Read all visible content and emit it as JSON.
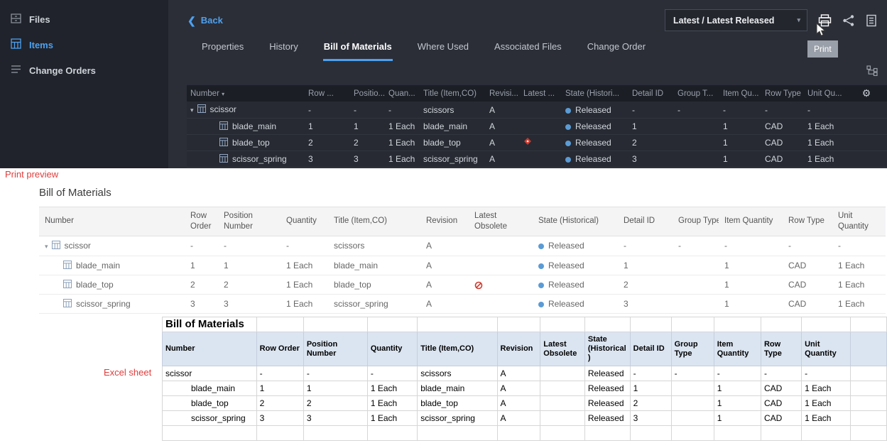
{
  "colors": {
    "accent_blue": "#4da1f0",
    "released_dot": "#5b9bd5",
    "obsolete_red": "#cf3a2d",
    "excel_header_bg": "#dbe5f1",
    "annotation_red": "#e03c3c"
  },
  "annotations": {
    "print_preview": "Print preview",
    "excel_sheet": "Excel sheet"
  },
  "sidebar": {
    "items": [
      {
        "label": "Files"
      },
      {
        "label": "Items"
      },
      {
        "label": "Change Orders"
      }
    ]
  },
  "toolbar": {
    "back_label": "Back",
    "version_selector": "Latest / Latest Released",
    "print_tooltip": "Print"
  },
  "tabs": [
    {
      "label": "Properties"
    },
    {
      "label": "History"
    },
    {
      "label": "Bill of Materials"
    },
    {
      "label": "Where Used"
    },
    {
      "label": "Associated Files"
    },
    {
      "label": "Change Order"
    }
  ],
  "dark_table": {
    "columns": [
      "Number",
      "Row ...",
      "Positio...",
      "Quan...",
      "Title (Item,CO)",
      "Revisi...",
      "Latest ...",
      "State (Histori...",
      "Detail ID",
      "Group T...",
      "Item Qu...",
      "Row Type",
      "Unit Qu..."
    ]
  },
  "rows": [
    {
      "number": "scissor",
      "row_order": "-",
      "position_number": "-",
      "quantity": "-",
      "title": "scissors",
      "revision": "A",
      "state": "Released",
      "detail_id": "-",
      "group_type": "-",
      "item_quantity": "-",
      "row_type": "-",
      "unit_quantity": "-"
    },
    {
      "number": "blade_main",
      "row_order": "1",
      "position_number": "1",
      "quantity": "1 Each",
      "title": "blade_main",
      "revision": "A",
      "state": "Released",
      "detail_id": "1",
      "group_type": "",
      "item_quantity": "1",
      "row_type": "CAD",
      "unit_quantity": "1 Each"
    },
    {
      "number": "blade_top",
      "row_order": "2",
      "position_number": "2",
      "quantity": "1 Each",
      "title": "blade_top",
      "revision": "A",
      "state": "Released",
      "detail_id": "2",
      "group_type": "",
      "item_quantity": "1",
      "row_type": "CAD",
      "unit_quantity": "1 Each"
    },
    {
      "number": "scissor_spring",
      "row_order": "3",
      "position_number": "3",
      "quantity": "1 Each",
      "title": "scissor_spring",
      "revision": "A",
      "state": "Released",
      "detail_id": "3",
      "group_type": "",
      "item_quantity": "1",
      "row_type": "CAD",
      "unit_quantity": "1 Each"
    }
  ],
  "print_preview": {
    "title": "Bill of Materials",
    "columns": [
      "Number",
      "Row Order",
      "Position Number",
      "Quantity",
      "Title (Item,CO)",
      "Revision",
      "Latest Obsolete",
      "State (Historical)",
      "Detail ID",
      "Group Type",
      "Item Quantity",
      "Row Type",
      "Unit Quantity"
    ]
  },
  "excel": {
    "title": "Bill of Materials",
    "columns": [
      "Number",
      "Row Order",
      "Position Number",
      "Quantity",
      "Title (Item,CO)",
      "Revision",
      "Latest Obsolete",
      "State (Historical )",
      "Detail ID",
      "Group Type",
      "Item Quantity",
      "Row Type",
      "Unit Quantity"
    ]
  }
}
